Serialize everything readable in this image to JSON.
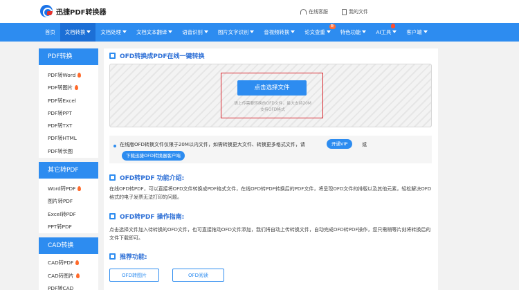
{
  "brand": {
    "name": "迅捷PDF转换器"
  },
  "top_links": {
    "service": "在线客服",
    "my_files": "我的文件"
  },
  "nav": {
    "items": [
      {
        "label": "首页",
        "caret": false
      },
      {
        "label": "文档转换",
        "caret": true,
        "active": true
      },
      {
        "label": "文档处理",
        "caret": true
      },
      {
        "label": "文档文本翻译",
        "caret": true
      },
      {
        "label": "语音识别",
        "caret": true
      },
      {
        "label": "图片文字识别",
        "caret": true
      },
      {
        "label": "音视频转换",
        "caret": true
      },
      {
        "label": "论文查重",
        "caret": true,
        "badge": "新"
      },
      {
        "label": "特色功能",
        "caret": true
      },
      {
        "label": "AI工具",
        "caret": true,
        "hot": true
      },
      {
        "label": "客户端",
        "caret": true
      }
    ]
  },
  "sidebar": {
    "group1": {
      "title": "PDF转换",
      "items": [
        "PDF转Word",
        "PDF转图片",
        "PDF转Excel",
        "PDF转PPT",
        "PDF转TXT",
        "PDF转HTML",
        "PDF转长图"
      ]
    },
    "group2": {
      "title": "其它转PDF",
      "items": [
        "Word转PDF",
        "图片转PDF",
        "Excel转PDF",
        "PPT转PDF"
      ]
    },
    "group3": {
      "title": "CAD转换",
      "items": [
        "CAD转PDF",
        "CAD转图片",
        "PDF转CAD"
      ]
    }
  },
  "main": {
    "title": "OFD转换成PDF在线一键转换",
    "upload_button": "点击选择文件",
    "upload_hint_1": "请上传需要转换的OFD文件，最大支持20M",
    "upload_hint_2": "支持OFD格式",
    "notice_text": "在线版OFD转换文件仅限于20M以内文件，如需转换更大文件、转换更多格式文件，请",
    "vip_button": "开通VIP",
    "or_text": "或",
    "download_button": "下载迅捷OFD转换器客户端",
    "intro_title": "OFD转PDF 功能介绍:",
    "intro_text": "在线OFD转PDF，可以直接将OFD文件转换成PDF格式文件，在线OFD转PDF转换后的PDF文件，将呈现OFD文件的排版以及其他元素，轻松解决OFD格式的电子发票无法打印的问题。",
    "guide_title": "OFD转PDF 操作指南:",
    "guide_text": "点击选择文件加入待转换的OFD文件，也可直接拖动OFD文件添加，我们将自动上传转换文件，自动完成OFD转PDF操作，您只需稍等片刻将转换后的文件下载即可。",
    "recommend_title": "推荐功能:",
    "recommend_items": [
      "OFD转图片",
      "OFD阅读"
    ]
  },
  "colors": {
    "primary": "#2d8cf0",
    "highlight": "#d8242c"
  }
}
